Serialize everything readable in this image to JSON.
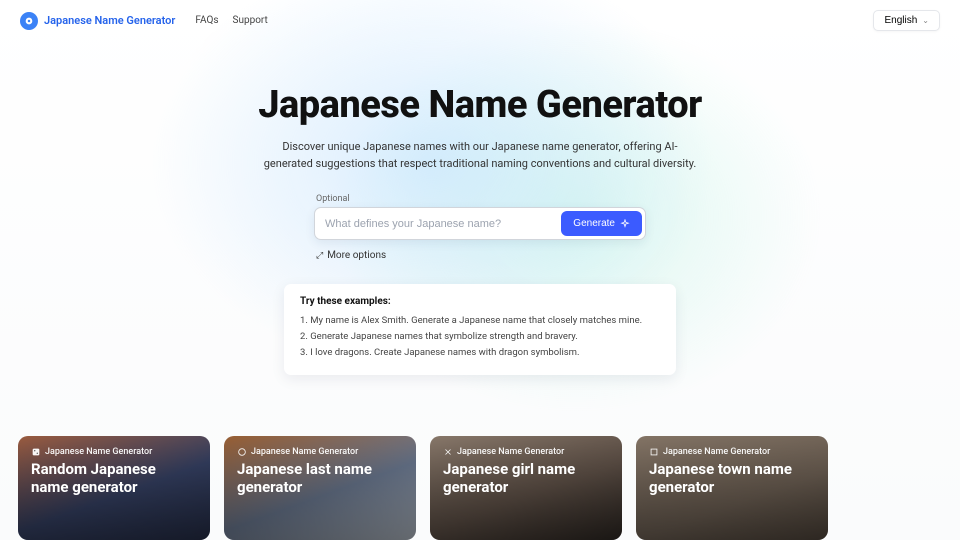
{
  "nav": {
    "logo_text": "Japanese Name Generator",
    "links": [
      "FAQs",
      "Support"
    ],
    "language": "English"
  },
  "hero": {
    "title": "Japanese Name Generator",
    "subtitle": "Discover unique Japanese names with our Japanese name generator, offering AI-generated suggestions that respect traditional naming conventions and cultural diversity."
  },
  "input": {
    "optional_label": "Optional",
    "placeholder": "What defines your Japanese name?",
    "generate_label": "Generate",
    "more_options_label": "More options"
  },
  "examples": {
    "heading": "Try these examples:",
    "items": [
      "1. My name is Alex Smith. Generate a Japanese name that closely matches mine.",
      "2. Generate Japanese names that symbolize strength and bravery.",
      "3. I love dragons. Create Japanese names with dragon symbolism."
    ]
  },
  "cards": {
    "brand_label": "Japanese Name Generator",
    "items": [
      {
        "title": "Random Japanese name generator"
      },
      {
        "title": "Japanese last name generator"
      },
      {
        "title": "Japanese girl name generator"
      },
      {
        "title": "Japanese town name generator"
      }
    ]
  }
}
